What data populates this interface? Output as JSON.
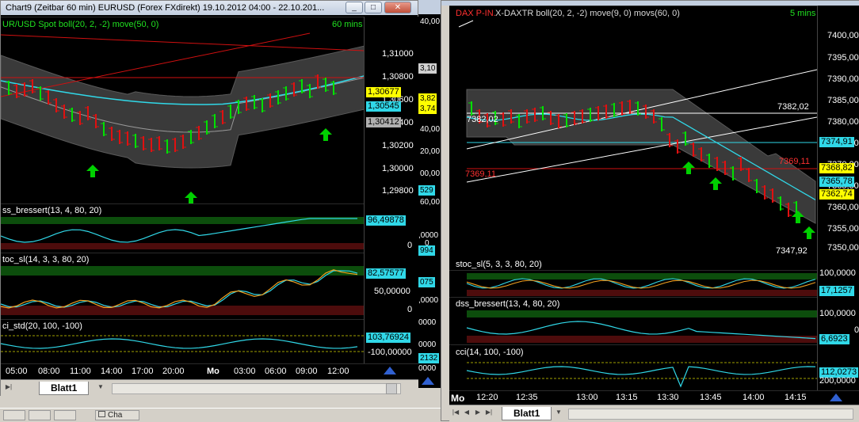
{
  "left_window": {
    "title": "Chart9 (Zeitbar 60 min)  EURUSD (Forex FXdirekt) 19.10.2012 04:00 - 22.10.201...",
    "price_header": "UR/USD Spot  boll(20, 2, -2) move(50, 0)",
    "interval": "60 mins",
    "price_ticks": [
      "1,31000",
      "1,30800",
      "1,30600",
      "1,30400",
      "1,30200",
      "1,30000",
      "1,29800"
    ],
    "tags": {
      "last": "1,30677",
      "move": "1,30545",
      "mid": "1,30412"
    },
    "dss_header": "ss_bressert(13, 4, 80, 20)",
    "dss_value": "96,49878",
    "dss_zero": "0",
    "stoc_header": "toc_sl(14, 3, 3, 80, 20)",
    "stoc_value": "82,57577",
    "stoc_ticks": [
      "50,00000",
      "0"
    ],
    "cci_header": "ci_std(20, 100, -100)",
    "cci_value": "103,76924",
    "cci_ticks": [
      "-100,00000"
    ],
    "time_labels": [
      "05:00",
      "08:00",
      "11:00",
      "14:00",
      "17:00",
      "20:00",
      "Mo",
      "03:00",
      "06:00",
      "09:00",
      "12:00"
    ],
    "tab_label": "Blatt1",
    "behind_ticks": [
      "40,00",
      "3,10",
      "3,82",
      "3,74",
      "40,00",
      "20,00",
      "00,00",
      "529",
      "60,00",
      ",0000",
      "0",
      "994",
      "075",
      ",0000",
      "0000",
      "0000",
      "2132",
      "0000"
    ]
  },
  "right_window": {
    "price_header_symbol": "DAX P-IN.",
    "price_header_rest": "  X-DAXTR  boll(20, 2, -2)  move(9, 0)  movs(60, 0)",
    "interval": "5 mins",
    "price_ticks": [
      "7400,00",
      "7395,00",
      "7390,00",
      "7385,00",
      "7380,00",
      "7375,00",
      "7370,00",
      "7365,00",
      "7360,00",
      "7355,00",
      "7350,00"
    ],
    "level_labels": {
      "high": "7382,02",
      "high_left": "7382,02",
      "low": "7369,11",
      "low_right": "7369,11",
      "bottom": "7347,92"
    },
    "tags": {
      "t1": "7374,91",
      "t2": "7368,82",
      "t3": "7365,78",
      "t4": "7362,74"
    },
    "stoc_header": "stoc_sl(5, 3, 3, 80, 20)",
    "stoc_ticks": [
      "100,0000",
      "0"
    ],
    "stoc_value": "17,1257",
    "dss_header": "dss_bressert(13, 4, 80, 20)",
    "dss_ticks": [
      "100,0000",
      "0"
    ],
    "dss_value": "6,6923",
    "cci_header": "cci(14, 100, -100)",
    "cci_ticks": [
      "200,0000"
    ],
    "cci_value": "112,0273",
    "time_labels": [
      "Mo",
      "12:20",
      "12:35",
      "13:00",
      "13:15",
      "13:30",
      "13:45",
      "14:00",
      "14:15"
    ],
    "tab_label": "Blatt1"
  },
  "taskbar": {
    "item_label": "Cha"
  },
  "colors": {
    "green_candle": "#00e000",
    "red_candle": "#e01010",
    "boll_band": "#3a3a3a",
    "cyan_line": "#30d8e8",
    "yellow_tag": "#ffff00"
  }
}
